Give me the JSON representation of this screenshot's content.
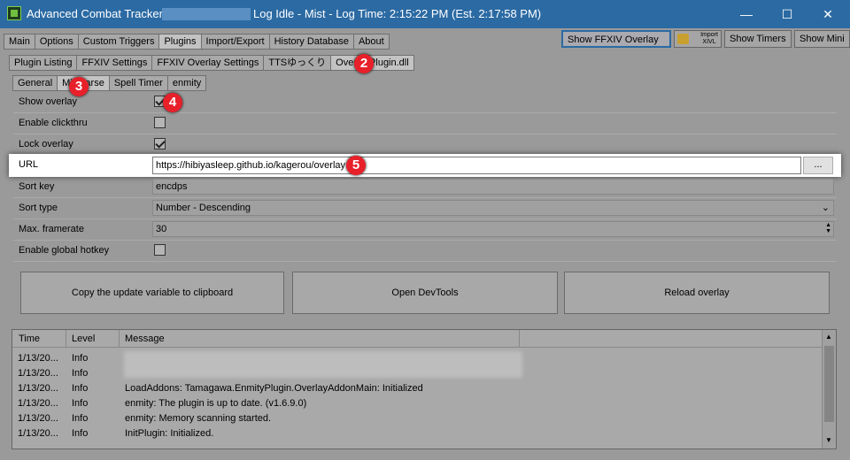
{
  "title": {
    "app": "Advanced Combat Tracker -",
    "status": "Log Idle - Mist - Log Time: 2:15:22 PM (Est. 2:17:58 PM)"
  },
  "window_controls": {
    "minimize": "—",
    "maximize": "☐",
    "close": "✕"
  },
  "main_tabs": [
    "Main",
    "Options",
    "Custom Triggers",
    "Plugins",
    "Import/Export",
    "History Database",
    "About"
  ],
  "right_buttons": {
    "show_overlay": "Show FFXIV Overlay",
    "import_xivl": "Import XIVL",
    "show_timers": "Show Timers",
    "show_mini": "Show Mini"
  },
  "plugin_tabs": [
    "Plugin Listing",
    "FFXIV Settings",
    "FFXIV Overlay Settings",
    "TTSゆっくり",
    "OverlayPlugin.dll"
  ],
  "overlay_tabs": [
    "General",
    "Miniparse",
    "Spell Timer",
    "enmity"
  ],
  "settings": {
    "show_overlay": "Show overlay",
    "enable_clickthru": "Enable clickthru",
    "lock_overlay": "Lock overlay",
    "url_label": "URL",
    "url_value": "https://hibiyasleep.github.io/kagerou/overlay",
    "browse": "...",
    "sort_key_label": "Sort key",
    "sort_key_value": "encdps",
    "sort_type_label": "Sort type",
    "sort_type_value": "Number - Descending",
    "framerate_label": "Max. framerate",
    "framerate_value": "30",
    "hotkey_label": "Enable global hotkey"
  },
  "checked": {
    "show_overlay": true,
    "enable_clickthru": false,
    "lock_overlay": true,
    "hotkey": false
  },
  "action_buttons": {
    "copy": "Copy the update variable to clipboard",
    "devtools": "Open DevTools",
    "reload": "Reload overlay"
  },
  "log": {
    "headers": {
      "time": "Time",
      "level": "Level",
      "message": "Message"
    },
    "rows": [
      {
        "time": "1/13/20...",
        "level": "Info",
        "message": ""
      },
      {
        "time": "1/13/20...",
        "level": "Info",
        "message": ""
      },
      {
        "time": "1/13/20...",
        "level": "Info",
        "message": "LoadAddons: Tamagawa.EnmityPlugin.OverlayAddonMain: Initialized"
      },
      {
        "time": "1/13/20...",
        "level": "Info",
        "message": "enmity: The plugin is up to date. (v1.6.9.0)"
      },
      {
        "time": "1/13/20...",
        "level": "Info",
        "message": "enmity: Memory scanning started."
      },
      {
        "time": "1/13/20...",
        "level": "Info",
        "message": "InitPlugin: Initialized."
      }
    ]
  },
  "badges": {
    "b2": "2",
    "b3": "3",
    "b4": "4",
    "b5": "5"
  }
}
